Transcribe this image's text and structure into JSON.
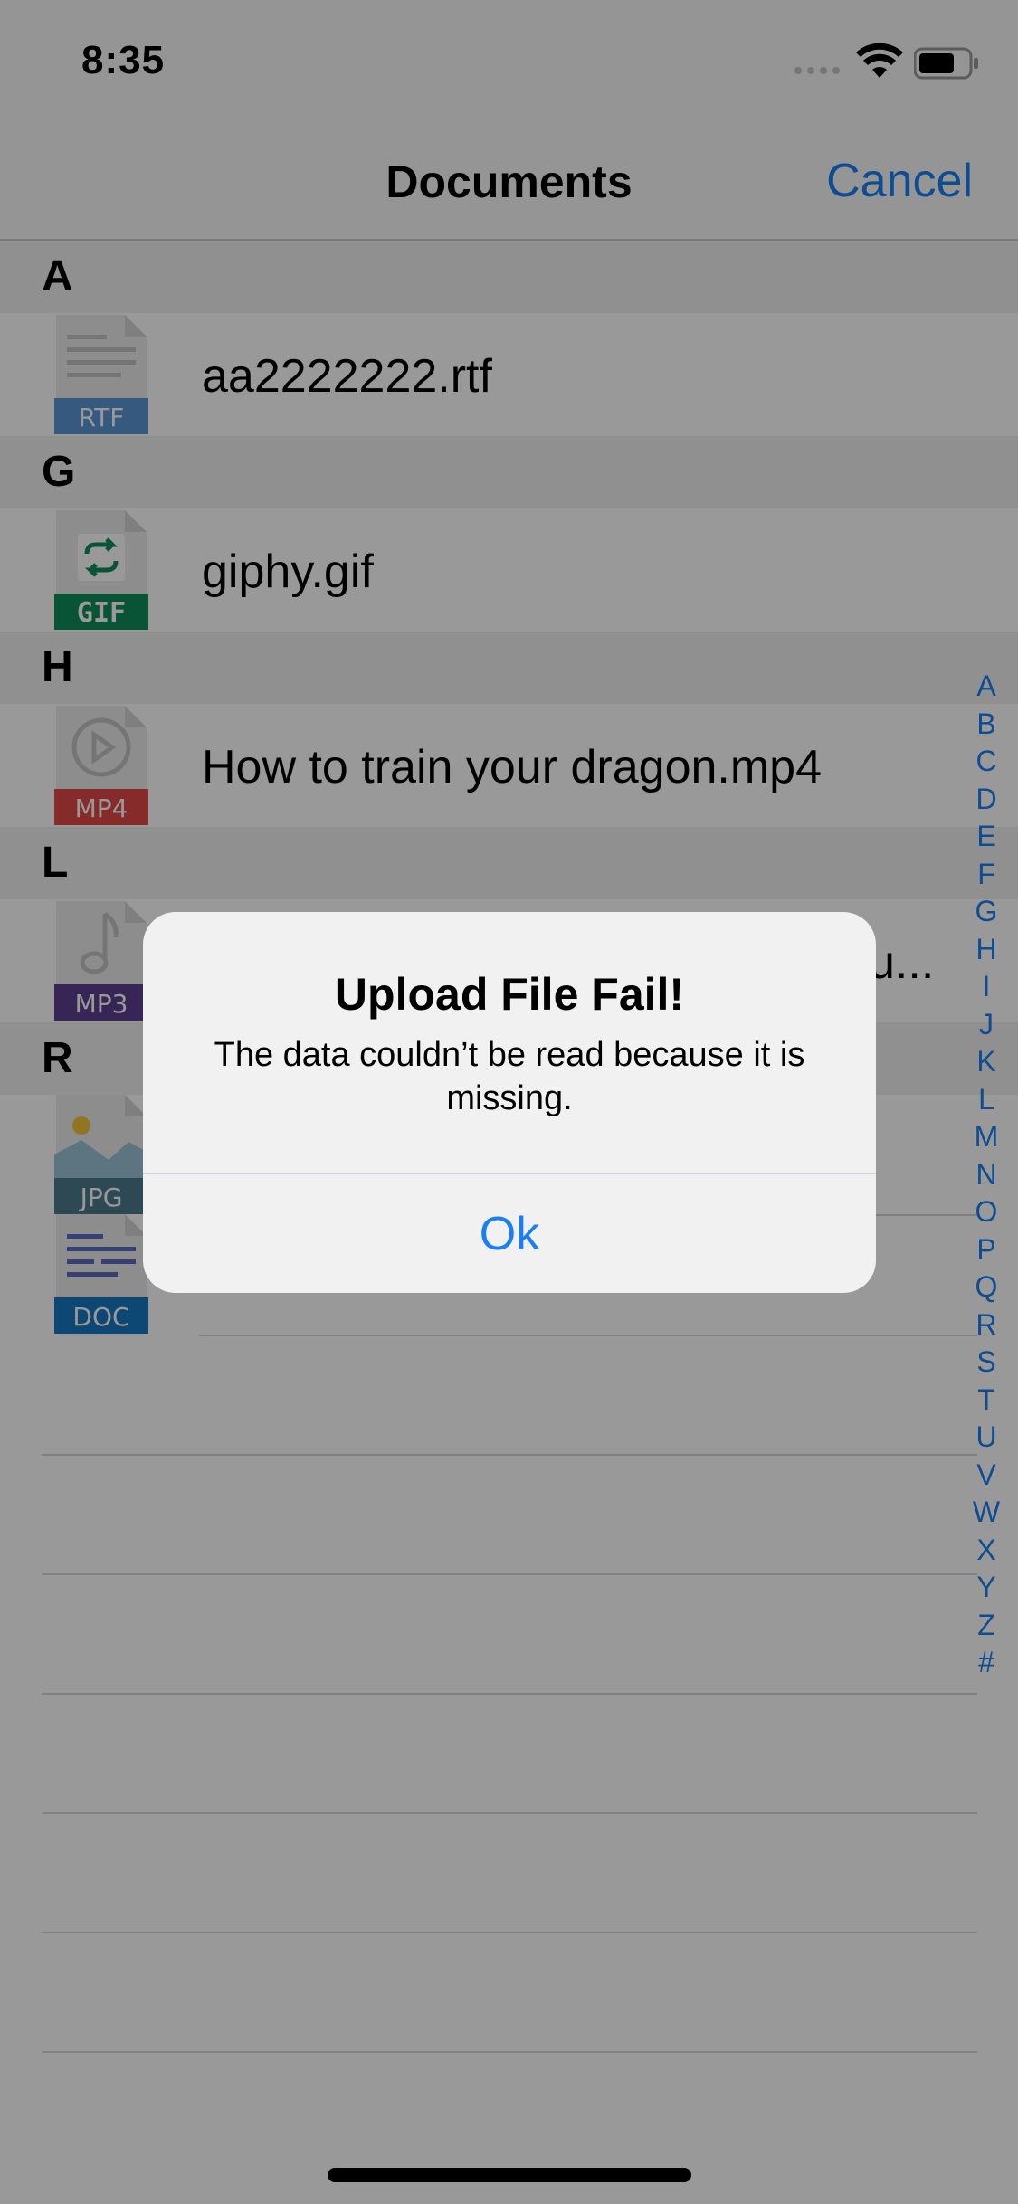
{
  "status": {
    "time": "8:35"
  },
  "nav": {
    "title": "Documents",
    "cancel": "Cancel"
  },
  "sections": [
    {
      "letter": "A",
      "file": {
        "name": "aa2222222.rtf",
        "badge": "RTF",
        "icon": "rtf-file-icon"
      }
    },
    {
      "letter": "G",
      "file": {
        "name": "giphy.gif",
        "badge": "GIF",
        "icon": "gif-file-icon"
      }
    },
    {
      "letter": "H",
      "file": {
        "name": "How to train your dragon.mp4",
        "badge": "MP4",
        "icon": "mp4-file-icon"
      }
    },
    {
      "letter": "L",
      "file": {
        "name": "u...",
        "badge": "MP3",
        "icon": "mp3-file-icon"
      }
    },
    {
      "letter": "R",
      "files": [
        {
          "name": "",
          "badge": "JPG",
          "icon": "jpg-file-icon"
        },
        {
          "name": "",
          "badge": "DOC",
          "icon": "doc-file-icon"
        }
      ]
    }
  ],
  "index": [
    "A",
    "B",
    "C",
    "D",
    "E",
    "F",
    "G",
    "H",
    "I",
    "J",
    "K",
    "L",
    "M",
    "N",
    "O",
    "P",
    "Q",
    "R",
    "S",
    "T",
    "U",
    "V",
    "W",
    "X",
    "Y",
    "Z",
    "#"
  ],
  "alert": {
    "title": "Upload File Fail!",
    "message": "The data couldn’t be read because it is missing.",
    "ok": "Ok"
  },
  "colors": {
    "accent": "#1a7ff0",
    "rtf": "#5b95d6",
    "gif": "#0f8c5a",
    "mp4": "#e04646",
    "mp3": "#5c3f8f",
    "jpg": "#4a7a8c",
    "doc": "#1779c4"
  }
}
